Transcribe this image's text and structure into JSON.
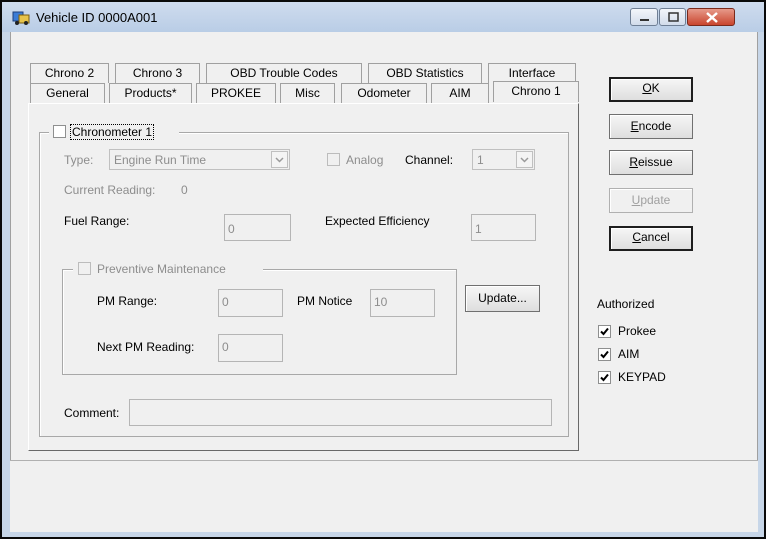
{
  "window": {
    "title": "Vehicle ID 0000A001"
  },
  "tabs": {
    "row_top": [
      "Chrono 2",
      "Chrono 3",
      "OBD Trouble Codes",
      "OBD Statistics",
      "Interface"
    ],
    "row_bottom": [
      "General",
      "Products*",
      "PROKEE",
      "Misc",
      "Odometer",
      "AIM",
      "Chrono 1"
    ],
    "active": "Chrono 1"
  },
  "chrono": {
    "group_label": "Chronometer 1",
    "type_label": "Type:",
    "type_value": "Engine Run Time",
    "analog_label": "Analog",
    "channel_label": "Channel:",
    "channel_value": "1",
    "current_reading_label": "Current Reading:",
    "current_reading_value": "0",
    "fuel_range_label": "Fuel Range:",
    "fuel_range_value": "0",
    "expected_efficiency_label": "Expected Efficiency",
    "expected_efficiency_value": "1",
    "comment_label": "Comment:",
    "comment_value": ""
  },
  "pm": {
    "group_label": "Preventive Maintenance",
    "pm_range_label": "PM Range:",
    "pm_range_value": "0",
    "pm_notice_label": "PM Notice",
    "pm_notice_value": "10",
    "next_pm_label": "Next PM Reading:",
    "next_pm_value": "0",
    "update_button": "Update..."
  },
  "buttons": {
    "ok": "OK",
    "encode": "Encode",
    "reissue": "Reissue",
    "update": "Update",
    "cancel": "Cancel"
  },
  "authorized": {
    "heading": "Authorized",
    "items": [
      {
        "label": "Prokee",
        "checked": true
      },
      {
        "label": "AIM",
        "checked": true
      },
      {
        "label": "KEYPAD",
        "checked": true
      }
    ]
  }
}
